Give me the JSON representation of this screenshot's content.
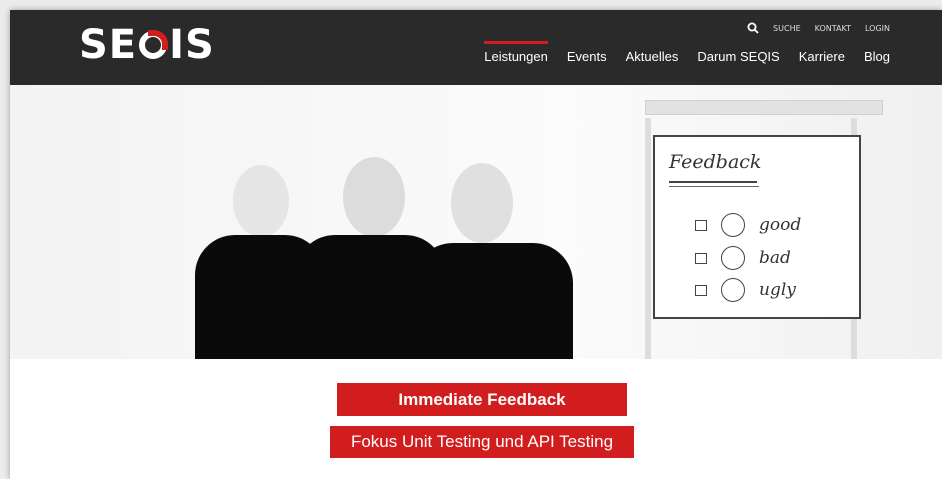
{
  "brand": {
    "logo_text_left": "SE",
    "logo_text_right": "IS",
    "logo_mark_color": "#d11d1d"
  },
  "top_nav": {
    "search_label": "SUCHE",
    "contact_label": "KONTAKT",
    "login_label": "LOGIN"
  },
  "main_nav": {
    "items": [
      {
        "label": "Leistungen",
        "active": true
      },
      {
        "label": "Events",
        "active": false
      },
      {
        "label": "Aktuelles",
        "active": false
      },
      {
        "label": "Darum SEQIS",
        "active": false
      },
      {
        "label": "Karriere",
        "active": false
      },
      {
        "label": "Blog",
        "active": false
      }
    ]
  },
  "hero": {
    "board": {
      "title": "Feedback",
      "rows": [
        {
          "label": "good"
        },
        {
          "label": "bad"
        },
        {
          "label": "ugly"
        }
      ]
    }
  },
  "cta": {
    "primary_label": "Immediate Feedback",
    "secondary_label": "Fokus Unit Testing und API Testing"
  },
  "colors": {
    "accent": "#d11d1d",
    "header_bg": "#2a2a2a"
  }
}
